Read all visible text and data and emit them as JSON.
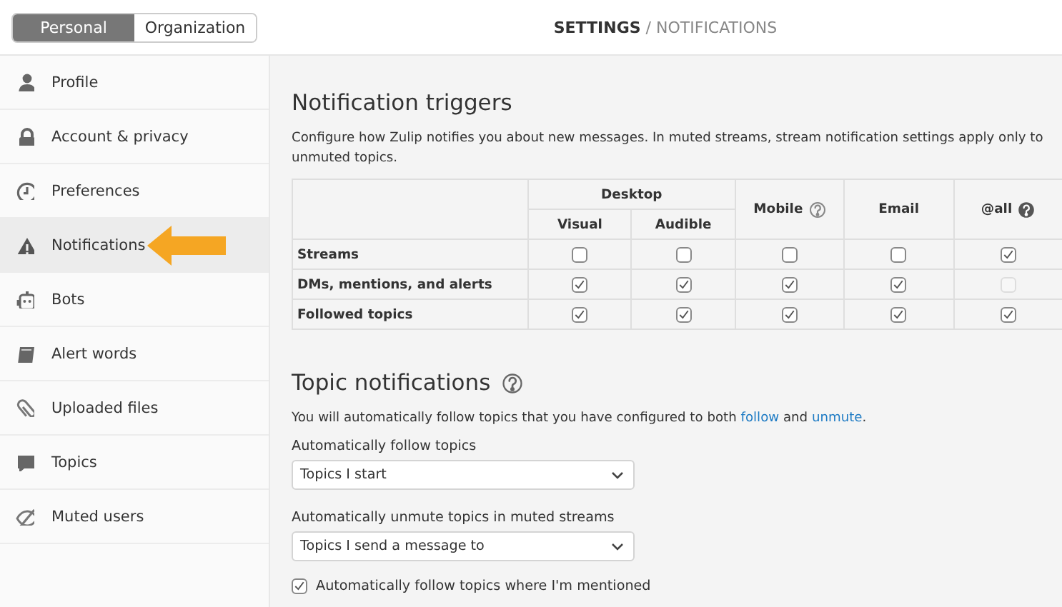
{
  "header": {
    "tabs": [
      {
        "label": "Personal",
        "selected": true
      },
      {
        "label": "Organization",
        "selected": false
      }
    ],
    "breadcrumb": {
      "section": "SETTINGS",
      "separator": "/",
      "page": "NOTIFICATIONS"
    }
  },
  "sidebar": {
    "items": [
      {
        "label": "Profile",
        "selected": false
      },
      {
        "label": "Account & privacy",
        "selected": false
      },
      {
        "label": "Preferences",
        "selected": false
      },
      {
        "label": "Notifications",
        "selected": true
      },
      {
        "label": "Bots",
        "selected": false
      },
      {
        "label": "Alert words",
        "selected": false
      },
      {
        "label": "Uploaded files",
        "selected": false
      },
      {
        "label": "Topics",
        "selected": false
      },
      {
        "label": "Muted users",
        "selected": false
      }
    ]
  },
  "notification_triggers": {
    "title": "Notification triggers",
    "description": "Configure how Zulip notifies you about new messages. In muted streams, stream notification settings apply only to unmuted topics.",
    "group_heading": "Desktop",
    "columns": [
      {
        "label": "Visual",
        "group": true
      },
      {
        "label": "Audible",
        "group": true
      },
      {
        "label": "Mobile",
        "group": false
      },
      {
        "label": "Email",
        "group": false
      },
      {
        "label": "@all",
        "group": false
      }
    ],
    "rows": [
      {
        "label": "Streams",
        "cells": [
          {
            "checked": false,
            "disabled": false
          },
          {
            "checked": false,
            "disabled": false
          },
          {
            "checked": false,
            "disabled": false
          },
          {
            "checked": false,
            "disabled": false
          },
          {
            "checked": true,
            "disabled": false
          }
        ]
      },
      {
        "label": "DMs, mentions, and alerts",
        "cells": [
          {
            "checked": true,
            "disabled": false
          },
          {
            "checked": true,
            "disabled": false
          },
          {
            "checked": true,
            "disabled": false
          },
          {
            "checked": true,
            "disabled": false
          },
          {
            "checked": false,
            "disabled": true
          }
        ]
      },
      {
        "label": "Followed topics",
        "cells": [
          {
            "checked": true,
            "disabled": false
          },
          {
            "checked": true,
            "disabled": false
          },
          {
            "checked": true,
            "disabled": false
          },
          {
            "checked": true,
            "disabled": false
          },
          {
            "checked": true,
            "disabled": false
          }
        ]
      }
    ]
  },
  "topic_notifications": {
    "title": "Topic notifications",
    "description_parts": [
      {
        "kind": "text",
        "text": "You will automatically follow topics that you have configured to both "
      },
      {
        "kind": "link",
        "text": "follow"
      },
      {
        "kind": "text",
        "text": " and "
      },
      {
        "kind": "link",
        "text": "unmute"
      },
      {
        "kind": "text",
        "text": "."
      }
    ],
    "selects": [
      {
        "label": "Automatically follow topics",
        "value": "Topics I start"
      },
      {
        "label": "Automatically unmute topics in muted streams",
        "value": "Topics I send a message to"
      }
    ],
    "checkbox": {
      "label": "Automatically follow topics where I'm mentioned",
      "checked": true
    }
  }
}
